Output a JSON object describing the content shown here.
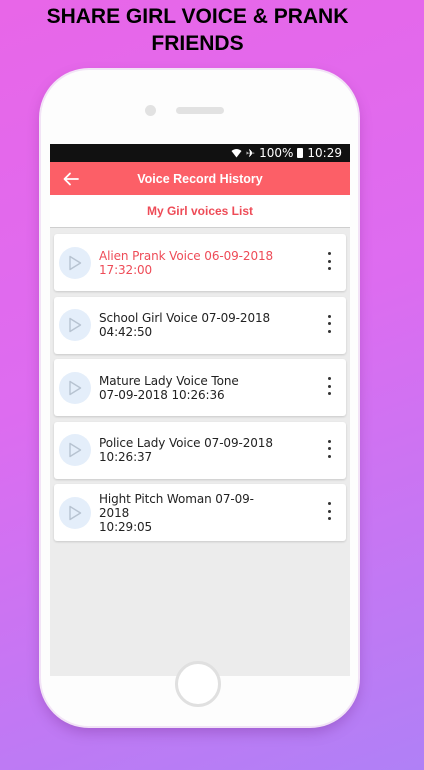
{
  "promo": {
    "line1": "SHARE GIRL VOICE & PRANK",
    "line2": "FRIENDS"
  },
  "statusbar": {
    "battery": "100%",
    "time": "10:29",
    "icons": [
      "wifi-icon",
      "airplane-icon",
      "battery-icon"
    ]
  },
  "appbar": {
    "title": "Voice Record History",
    "back_icon": "arrow-left-icon"
  },
  "subheader": {
    "title": "My Girl voices List"
  },
  "recordings": [
    {
      "line1": "Alien Prank Voice 06-09-2018",
      "line2": "17:32:00",
      "active": true
    },
    {
      "line1": "School Girl Voice 07-09-2018",
      "line2": "04:42:50",
      "active": false
    },
    {
      "line1": "Mature Lady Voice Tone",
      "line2": "07-09-2018 10:26:36",
      "active": false
    },
    {
      "line1": "Police Lady Voice 07-09-2018",
      "line2": "10:26:37",
      "active": false
    },
    {
      "line1": "Hight Pitch Woman 07-09-2018",
      "line2": "10:29:05",
      "active": false
    }
  ],
  "colors": {
    "accent": "#fc5f67",
    "active_text": "#ee4b57",
    "play_bg": "#e4eefa"
  }
}
